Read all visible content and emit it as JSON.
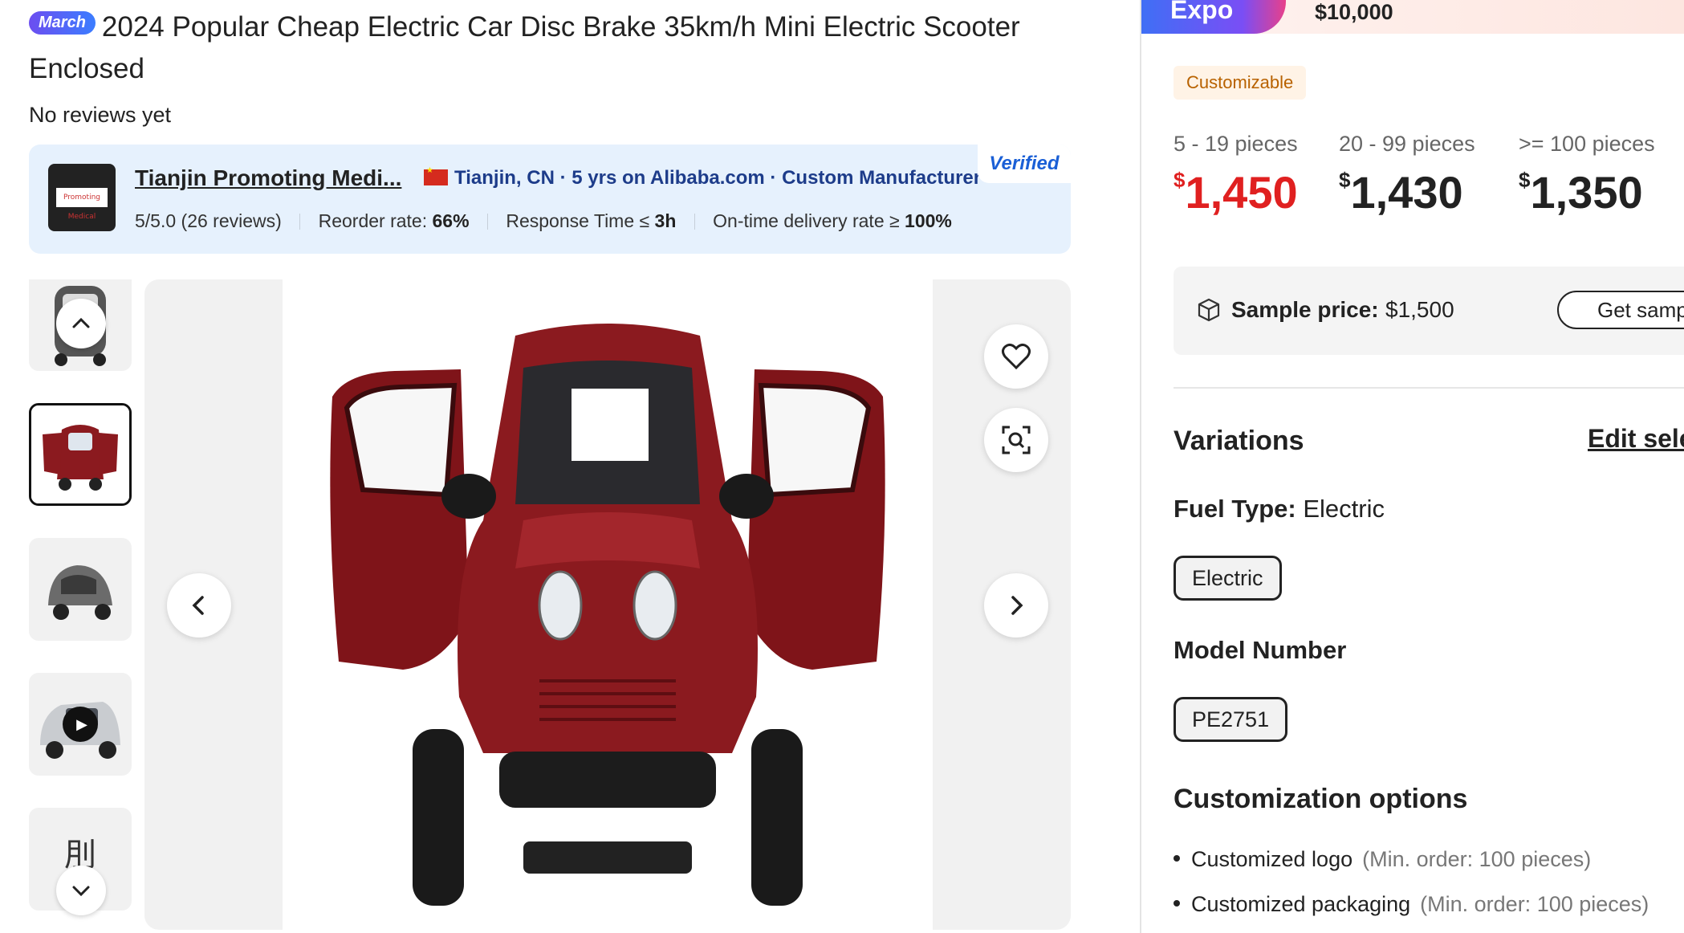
{
  "product": {
    "badge": "March",
    "title": "2024 Popular Cheap Electric Car Disc Brake 35km/h Mini Electric Scooter Enclosed",
    "reviews": "No reviews yet"
  },
  "supplier": {
    "name": "Tianjin Promoting Medi...",
    "location": "Tianjin, CN",
    "years": "5 yrs on Alibaba.com",
    "type": "Custom Manufacturer",
    "verified": "Verified",
    "rating": "5/5.0",
    "rating_count": "(26 reviews)",
    "reorder_label": "Reorder rate:",
    "reorder_value": "66%",
    "response_label": "Response Time ≤",
    "response_value": "3h",
    "ontime_label": "On-time delivery rate ≥",
    "ontime_value": "100%",
    "logo_text": "Promoting Medical"
  },
  "gallery": {
    "up_icon": "chevron-up-icon",
    "down_icon": "chevron-down-icon",
    "prev_icon": "chevron-left-icon",
    "next_icon": "chevron-right-icon",
    "favorite_icon": "heart-icon",
    "visual_search_icon": "image-search-icon"
  },
  "expo": {
    "label": "Expo",
    "price": "$10,000"
  },
  "customizable": "Customizable",
  "tiers": [
    {
      "qty": "5 - 19 pieces",
      "currency": "$",
      "price": "1,450"
    },
    {
      "qty": "20 - 99 pieces",
      "currency": "$",
      "price": "1,430"
    },
    {
      "qty": ">= 100 pieces",
      "currency": "$",
      "price": "1,350"
    }
  ],
  "sample": {
    "label": "Sample price:",
    "value": "$1,500",
    "button": "Get samples"
  },
  "variations": {
    "title": "Variations",
    "edit": "Edit selections",
    "fuel_label": "Fuel Type:",
    "fuel_value": "Electric",
    "fuel_option": "Electric",
    "model_label": "Model Number",
    "model_option": "PE2751"
  },
  "customization": {
    "title": "Customization options",
    "items": [
      {
        "name": "Customized logo",
        "note": "(Min. order: 100 pieces)"
      },
      {
        "name": "Customized packaging",
        "note": "(Min. order: 100 pieces)"
      }
    ]
  },
  "colors": {
    "accent_red": "#e02020",
    "car_red": "#8b1a1f",
    "verified_blue": "#1a5fd6"
  }
}
